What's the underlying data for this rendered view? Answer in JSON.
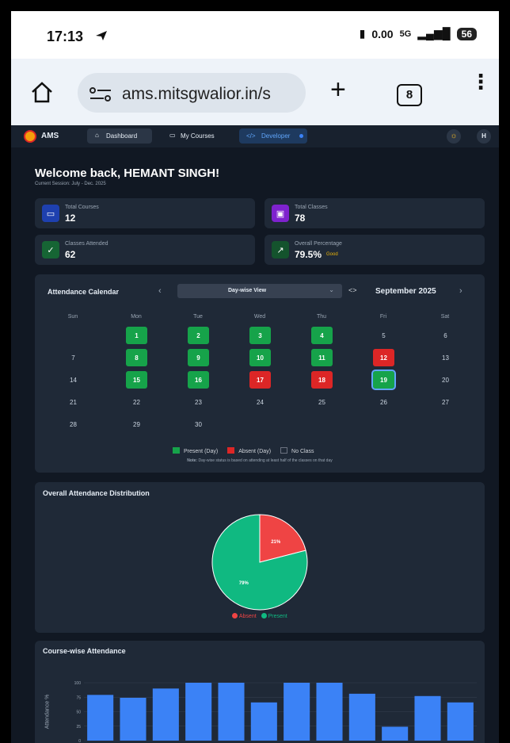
{
  "status_bar": {
    "time": "17:13",
    "net_speed": "0.00",
    "net_unit": "KB/S",
    "net_type": "5G",
    "battery": "56"
  },
  "browser": {
    "url": "ams.mitsgwalior.in/s",
    "tab_count": "8"
  },
  "nav": {
    "brand": "AMS",
    "dashboard": "Dashboard",
    "my_courses": "My Courses",
    "developer": "Developer",
    "avatar": "H"
  },
  "welcome": {
    "title": "Welcome back, HEMANT SINGH!",
    "session": "Current Session: July - Dec. 2025"
  },
  "stats": {
    "total_courses": {
      "label": "Total Courses",
      "value": "12"
    },
    "total_classes": {
      "label": "Total Classes",
      "value": "78"
    },
    "classes_attended": {
      "label": "Classes Attended",
      "value": "62"
    },
    "overall_percentage": {
      "label": "Overall Percentage",
      "value": "79.5%",
      "badge": "Good"
    }
  },
  "calendar": {
    "title": "Attendance Calendar",
    "view": "Day-wise View",
    "month": "September 2025",
    "weekdays": [
      "Sun",
      "Mon",
      "Tue",
      "Wed",
      "Thu",
      "Fri",
      "Sat"
    ],
    "days": [
      {
        "d": "1",
        "s": "p"
      },
      {
        "d": "2",
        "s": "p"
      },
      {
        "d": "3",
        "s": "p"
      },
      {
        "d": "4",
        "s": "p"
      },
      {
        "d": "5",
        "s": "n"
      },
      {
        "d": "6",
        "s": "n"
      },
      {
        "d": "7",
        "s": "n"
      },
      {
        "d": "8",
        "s": "p"
      },
      {
        "d": "9",
        "s": "p"
      },
      {
        "d": "10",
        "s": "p"
      },
      {
        "d": "11",
        "s": "p"
      },
      {
        "d": "12",
        "s": "a"
      },
      {
        "d": "13",
        "s": "n"
      },
      {
        "d": "14",
        "s": "n"
      },
      {
        "d": "15",
        "s": "p"
      },
      {
        "d": "16",
        "s": "p"
      },
      {
        "d": "17",
        "s": "a"
      },
      {
        "d": "18",
        "s": "a"
      },
      {
        "d": "19",
        "s": "t"
      },
      {
        "d": "20",
        "s": "n"
      },
      {
        "d": "21",
        "s": "n"
      },
      {
        "d": "22",
        "s": "n"
      },
      {
        "d": "23",
        "s": "n"
      },
      {
        "d": "24",
        "s": "n"
      },
      {
        "d": "25",
        "s": "n"
      },
      {
        "d": "26",
        "s": "n"
      },
      {
        "d": "27",
        "s": "n"
      },
      {
        "d": "28",
        "s": "n"
      },
      {
        "d": "29",
        "s": "n"
      },
      {
        "d": "30",
        "s": "n"
      }
    ],
    "legend": {
      "present": "Present (Day)",
      "absent": "Absent (Day)",
      "none": "No Class"
    },
    "note_label": "Note:",
    "note": "Day-wise status is based on attending at least half of the classes on that day"
  },
  "distribution": {
    "title": "Overall Attendance Distribution",
    "absent_pct": "21%",
    "present_pct": "79%",
    "legend_absent": "Absent",
    "legend_present": "Present"
  },
  "course_chart": {
    "title": "Course-wise Attendance",
    "ylabel": "Attendance %"
  },
  "chart_data": [
    {
      "type": "pie",
      "title": "Overall Attendance Distribution",
      "labels": [
        "Absent",
        "Present"
      ],
      "values": [
        21,
        79
      ],
      "colors": [
        "#ef4444",
        "#10b981"
      ]
    },
    {
      "type": "bar",
      "title": "Course-wise Attendance",
      "ylabel": "Attendance %",
      "ylim": [
        0,
        100
      ],
      "yticks": [
        0,
        25,
        50,
        75,
        100
      ],
      "values": [
        79,
        74,
        90,
        100,
        100,
        66,
        100,
        100,
        81,
        24,
        77,
        66
      ],
      "color": "#3b82f6",
      "categories_visible": false
    }
  ],
  "colors": {
    "present": "#16a34a",
    "absent": "#dc2626",
    "bg": "#111823",
    "card": "#1f2937",
    "accent": "#3b82f6"
  }
}
